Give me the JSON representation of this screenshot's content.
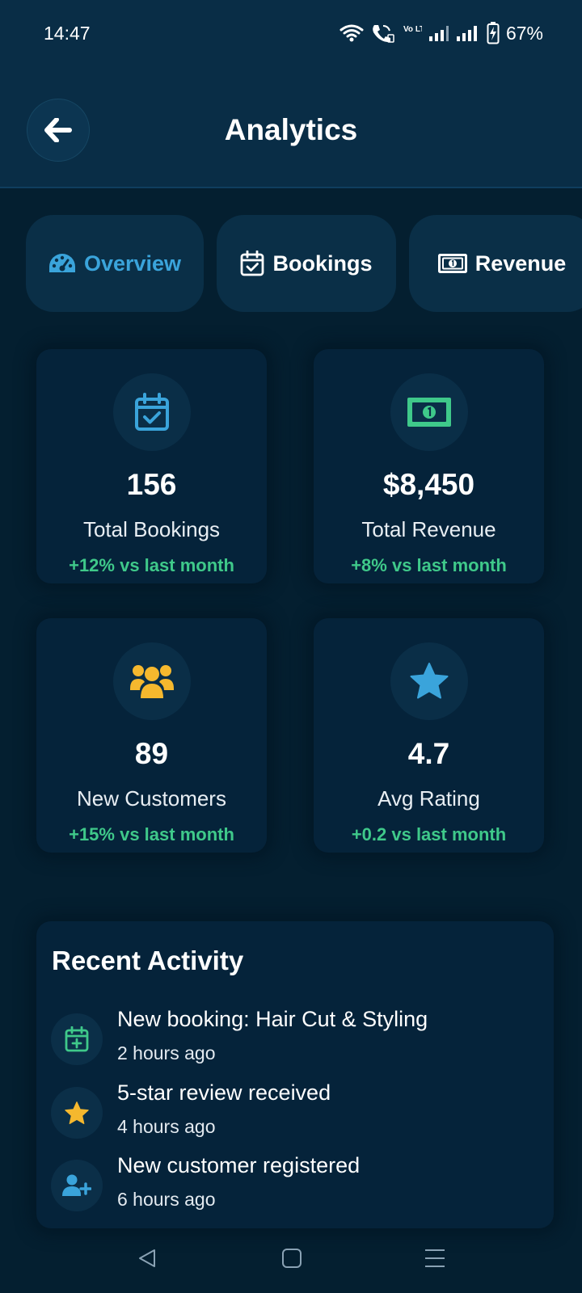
{
  "status_bar": {
    "time": "14:47",
    "volte_label": "Vo LTE",
    "battery_percent": "67%",
    "icons": [
      "wifi-icon",
      "wifi-calling-icon",
      "volte-icon",
      "signal-icon",
      "signal-icon",
      "battery-charging-icon"
    ]
  },
  "header": {
    "title": "Analytics",
    "back_icon": "arrow-left-icon"
  },
  "tabs": [
    {
      "label": "Overview",
      "icon": "gauge-icon",
      "active": true
    },
    {
      "label": "Bookings",
      "icon": "calendar-check-icon",
      "active": false
    },
    {
      "label": "Revenue",
      "icon": "money-bill-icon",
      "active": false
    }
  ],
  "stats": [
    {
      "value": "156",
      "label": "Total Bookings",
      "change": "+12% vs last month",
      "icon": "calendar-check-icon",
      "icon_color": "#3aa4db"
    },
    {
      "value": "$8,450",
      "label": "Total Revenue",
      "change": "+8% vs last month",
      "icon": "money-bill-icon",
      "icon_color": "#3fc98a"
    },
    {
      "value": "89",
      "label": "New Customers",
      "change": "+15% vs last month",
      "icon": "users-icon",
      "icon_color": "#f5b82e"
    },
    {
      "value": "4.7",
      "label": "Avg Rating",
      "change": "+0.2 vs last month",
      "icon": "star-icon",
      "icon_color": "#3aa4db"
    }
  ],
  "recent_activity": {
    "title": "Recent Activity",
    "items": [
      {
        "text": "New booking: Hair Cut & Styling",
        "time": "2 hours ago",
        "icon": "calendar-plus-icon",
        "icon_color": "#3fc98a"
      },
      {
        "text": "5-star review received",
        "time": "4 hours ago",
        "icon": "star-icon",
        "icon_color": "#f5b82e"
      },
      {
        "text": "New customer registered",
        "time": "6 hours ago",
        "icon": "user-plus-icon",
        "icon_color": "#3aa4db"
      }
    ]
  },
  "nav_bar": {
    "icons": [
      "back-triangle-icon",
      "home-square-icon",
      "menu-lines-icon"
    ]
  },
  "colors": {
    "background": "#041f30",
    "header": "#092d46",
    "card": "#05233a",
    "accent_blue": "#3aa4db",
    "accent_green": "#3fc98a",
    "accent_yellow": "#f5b82e"
  }
}
